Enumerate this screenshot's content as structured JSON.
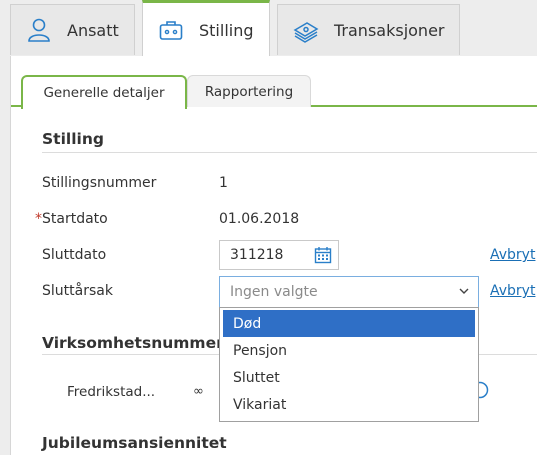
{
  "top_tabs": [
    {
      "label": "Ansatt",
      "icon": "person-icon"
    },
    {
      "label": "Stilling",
      "icon": "briefcase-icon"
    },
    {
      "label": "Transaksjoner",
      "icon": "money-stack-icon"
    }
  ],
  "sub_tabs": [
    {
      "label": "Generelle detaljer"
    },
    {
      "label": "Rapportering"
    }
  ],
  "sections": {
    "stilling": "Stilling",
    "virksomhet": "Virksomhetsnummer",
    "jubileum": "Jubileumsansiennitet"
  },
  "fields": {
    "stillingsnummer_label": "Stillingsnummer",
    "stillingsnummer_value": "1",
    "startdato_required": "*",
    "startdato_label": "Startdato",
    "startdato_value": "01.06.2018",
    "sluttdato_label": "Sluttdato",
    "sluttdato_value": "311218",
    "sluttarsak_label": "Sluttårsak",
    "sluttarsak_placeholder": "Ingen valgte"
  },
  "links": {
    "avbryt1": "Avbryt",
    "avbryt2": "Avbryt"
  },
  "dropdown_options": [
    "Død",
    "Pensjon",
    "Sluttet",
    "Vikariat"
  ],
  "selected_option": "Død",
  "virksomhet_row": {
    "label": "Fredrikstad...",
    "extra": "∞"
  },
  "colors": {
    "accent_green": "#7ab648",
    "link_blue": "#1a6fb5",
    "selected_blue": "#2f6fc6"
  }
}
